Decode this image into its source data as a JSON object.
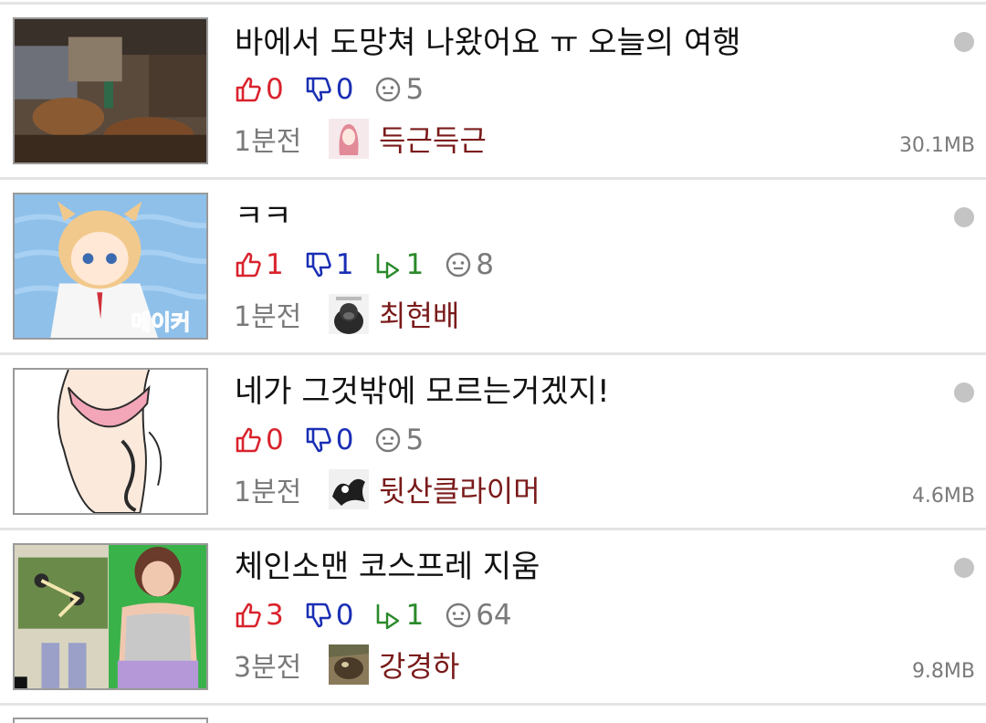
{
  "posts": [
    {
      "title": "바에서 도망쳐 나왔어요 ㅠ 오늘의 여행",
      "likes": "0",
      "dislikes": "0",
      "replies": null,
      "comments": "5",
      "time": "1분전",
      "author": "득근득근",
      "size": "30.1MB"
    },
    {
      "title": "ㅋㅋ",
      "likes": "1",
      "dislikes": "1",
      "replies": "1",
      "comments": "8",
      "time": "1분전",
      "author": "최현배",
      "size": ""
    },
    {
      "title": "네가 그것밖에 모르는거겠지!",
      "likes": "0",
      "dislikes": "0",
      "replies": null,
      "comments": "5",
      "time": "1분전",
      "author": "뒷산클라이머",
      "size": "4.6MB"
    },
    {
      "title": "체인소맨 코스프레 지움",
      "likes": "3",
      "dislikes": "0",
      "replies": "1",
      "comments": "64",
      "time": "3분전",
      "author": "강경하",
      "size": "9.8MB"
    }
  ],
  "icons": {
    "like": "thumbs-up-icon",
    "dislike": "thumbs-down-icon",
    "reply": "reply-icon",
    "comment": "comment-icon"
  },
  "thumb_text": {
    "post2": "메이커"
  },
  "colors": {
    "like": "#d9232d",
    "dislike": "#1a2fb4",
    "reply": "#2a8a2a",
    "author": "#7a1a1a",
    "muted": "#7a7a7a",
    "unread_dot": "#c4c4c4"
  }
}
